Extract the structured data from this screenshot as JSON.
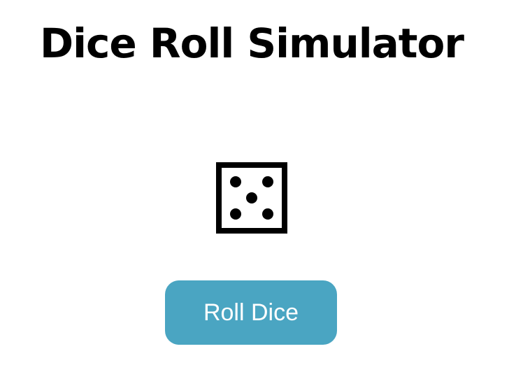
{
  "page": {
    "title": "Dice Roll Simulator"
  },
  "dice": {
    "value": 5,
    "icon": "dice-five-icon"
  },
  "actions": {
    "roll_label": "Roll Dice"
  },
  "colors": {
    "button_background": "#4aa5c2",
    "button_text": "#ffffff",
    "title_text": "#000000",
    "die_stroke": "#000000"
  }
}
